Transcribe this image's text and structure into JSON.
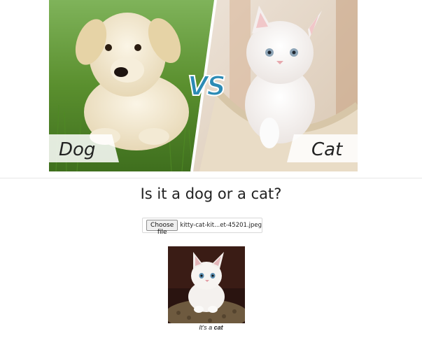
{
  "hero": {
    "dog_label": "Dog",
    "vs_label": "VS",
    "cat_label": "Cat"
  },
  "title": "Is it a dog or a cat?",
  "file_input": {
    "button_label": "Choose file",
    "file_name": "kitty-cat-kit...et-45201.jpeg"
  },
  "result": {
    "prefix": "It's a ",
    "label": "cat"
  },
  "colors": {
    "vs_fill": "#2c8bb5",
    "grass": "#6a9e3a",
    "bed": "#e7d7bf"
  }
}
